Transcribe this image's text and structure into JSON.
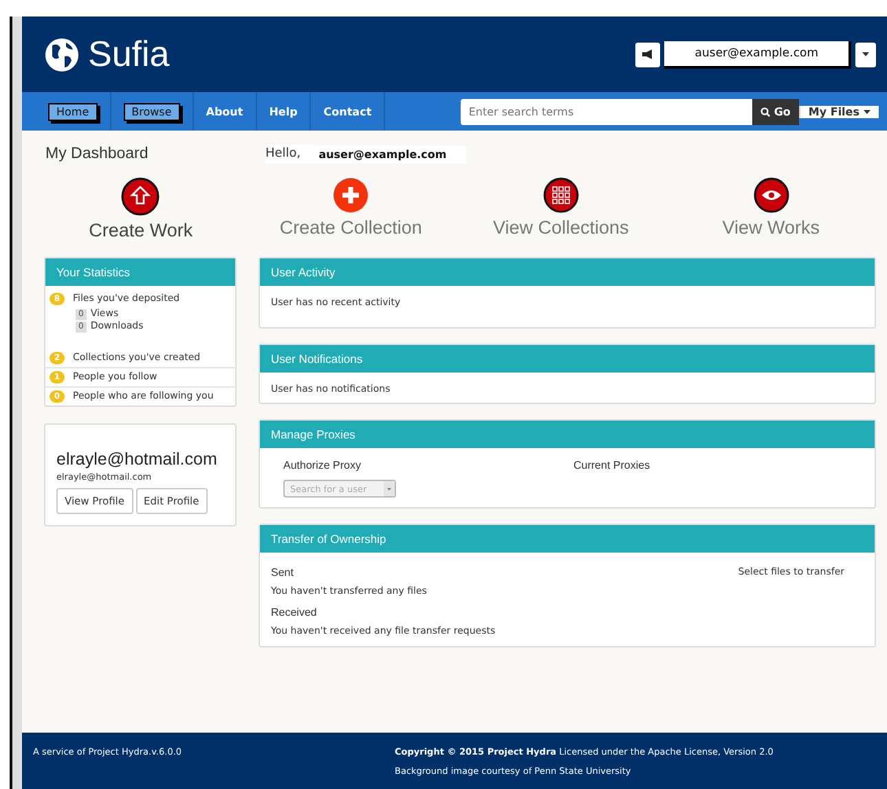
{
  "header": {
    "brand": "Sufia",
    "user": "auser@example.com"
  },
  "nav": [
    {
      "label": "Home",
      "highlighted": true
    },
    {
      "label": "Browse",
      "highlighted": true
    },
    {
      "label": "About",
      "highlighted": false
    },
    {
      "label": "Help",
      "highlighted": false
    },
    {
      "label": "Contact",
      "highlighted": false
    }
  ],
  "search": {
    "placeholder": "Enter search terms",
    "button": "Go",
    "menu": "My Files"
  },
  "dashboard": {
    "title": "My Dashboard",
    "greeting": "Hello,",
    "user": "auser@example.com"
  },
  "actions": [
    {
      "label": "Create Work"
    },
    {
      "label": "Create Collection"
    },
    {
      "label": "View Collections"
    },
    {
      "label": "View Works"
    }
  ],
  "statistics": {
    "title": "Your Statistics",
    "items": [
      {
        "count": "8",
        "label": "Files you've deposited",
        "details": [
          {
            "count": "0",
            "label": "Views"
          },
          {
            "count": "0",
            "label": "Downloads"
          }
        ]
      },
      {
        "count": "2",
        "label": "Collections you've created"
      },
      {
        "count": "1",
        "label": "People you follow"
      },
      {
        "count": "0",
        "label": "People who are following you"
      }
    ]
  },
  "profile": {
    "name": "elrayle@hotmail.com",
    "email": "elrayle@hotmail.com",
    "buttons": [
      "View Profile",
      "Edit Profile"
    ]
  },
  "activity": {
    "title": "User Activity",
    "message": "User has no recent activity"
  },
  "notifications": {
    "title": "User Notifications",
    "message": "User has no notifications"
  },
  "proxies": {
    "title": "Manage Proxies",
    "authorize": "Authorize Proxy",
    "current": "Current Proxies",
    "placeholder": "Search for a user"
  },
  "transfer": {
    "title": "Transfer of Ownership",
    "sent": "Sent",
    "sent_message": "You haven't transferred any files",
    "select": "Select files to transfer",
    "received": "Received",
    "received_message": "You haven't received any file transfer requests"
  },
  "footer": {
    "service": "A service of Project Hydra.v.6.0.0",
    "copyright": "**Copyright © 2015 Project Hydra** Licensed under the Apache License, Version 2.0",
    "credit": "Background image courtesy of Penn State University"
  }
}
